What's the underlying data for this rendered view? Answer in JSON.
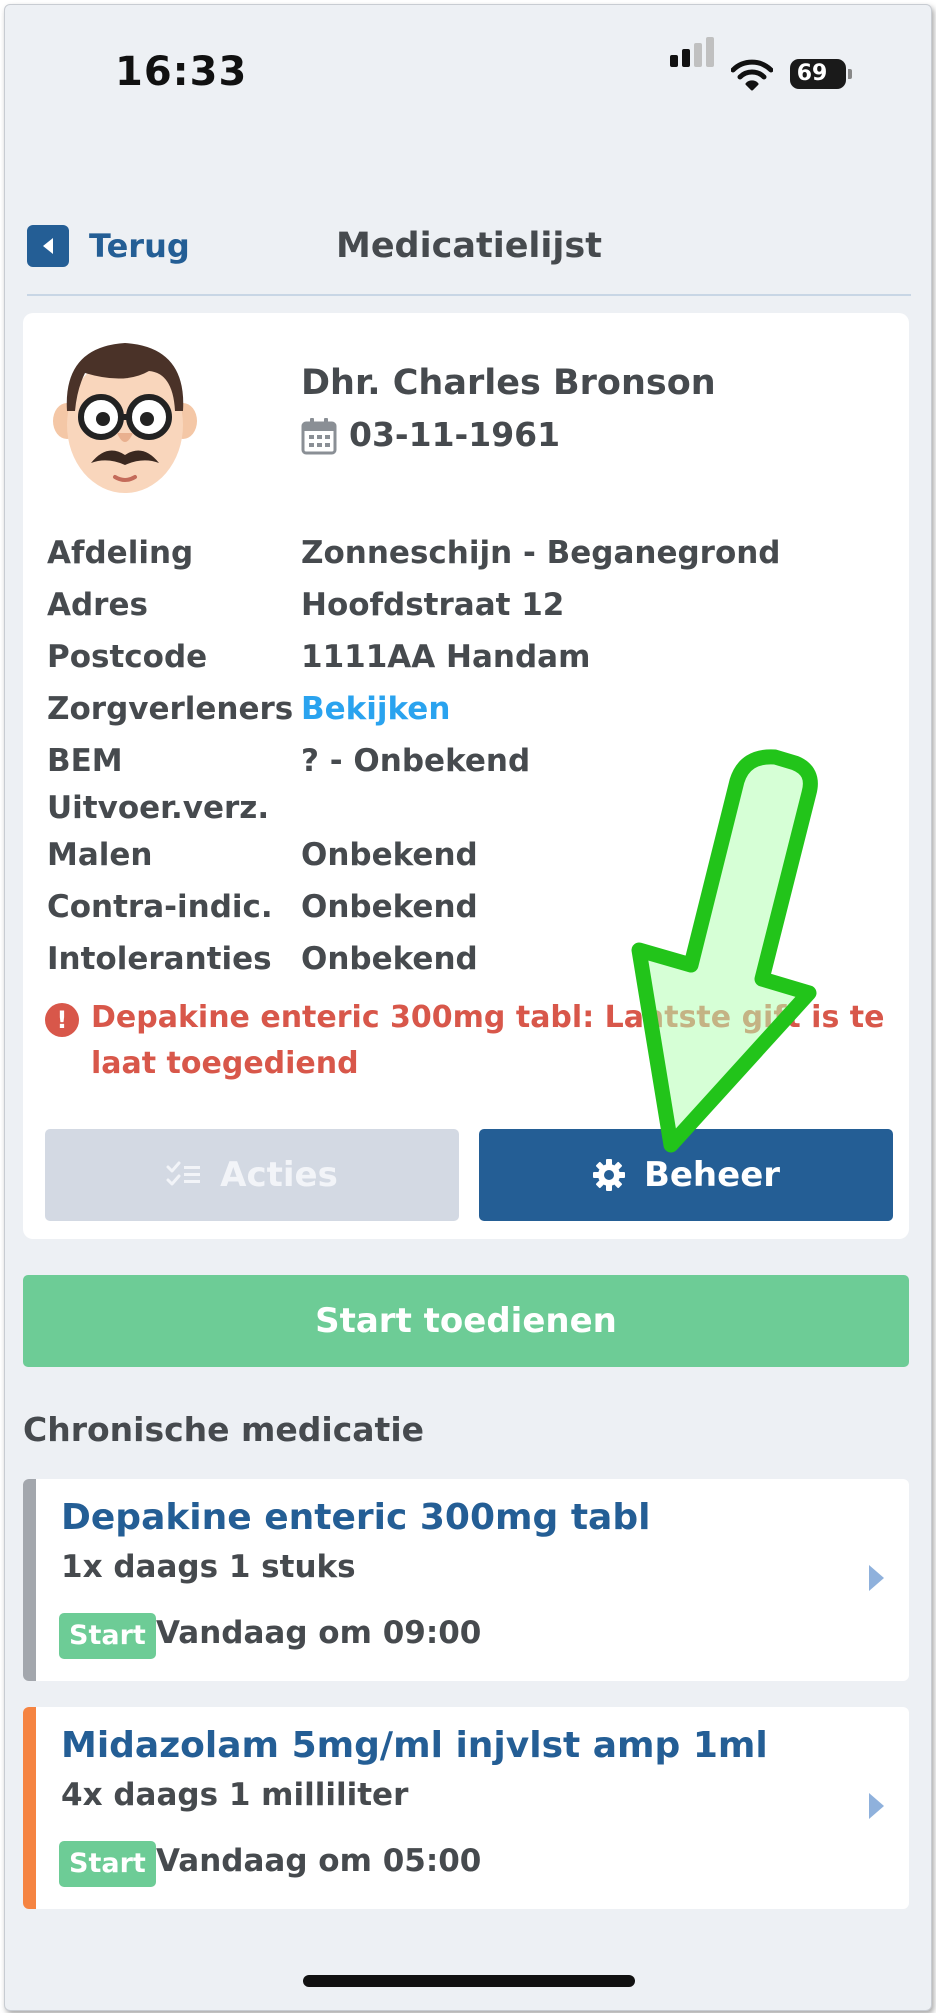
{
  "status_bar": {
    "time": "16:33",
    "battery": "69"
  },
  "nav": {
    "back_label": "Terug",
    "title": "Medicatielijst"
  },
  "patient": {
    "name": "Dhr. Charles Bronson",
    "dob": "03-11-1961",
    "fields": [
      {
        "label": "Afdeling",
        "value": "Zonneschijn - Beganegrond"
      },
      {
        "label": "Adres",
        "value": "Hoofdstraat 12"
      },
      {
        "label": "Postcode",
        "value": "1111AA Handam"
      },
      {
        "label": "Zorgverleners",
        "value": "Bekijken"
      },
      {
        "label": "BEM",
        "value": "? - Onbekend"
      },
      {
        "label": "Uitvoer.verz.",
        "value": ""
      },
      {
        "label": "Malen",
        "value": "Onbekend"
      },
      {
        "label": "Contra-indic.",
        "value": "Onbekend"
      },
      {
        "label": "Intoleranties",
        "value": "Onbekend"
      }
    ],
    "alert": "Depakine enteric 300mg tabl: Laatste gift is te laat toegediend"
  },
  "actions": {
    "acties_label": "Acties",
    "beheer_label": "Beheer"
  },
  "start_button_label": "Start toedienen",
  "section_title": "Chronische medicatie",
  "medications": [
    {
      "name": "Depakine enteric 300mg tabl",
      "dose": "1x daags 1 stuks",
      "badge": "Start",
      "time": "Vandaag om 09:00",
      "bar_color": "#a3a7ad"
    },
    {
      "name": "Midazolam 5mg/ml injvlst amp 1ml",
      "dose": "4x daags 1 milliliter",
      "badge": "Start",
      "time": "Vandaag om 05:00",
      "bar_color": "#f58442"
    }
  ],
  "colors": {
    "primary": "#245e95",
    "success": "#6dcc96",
    "danger": "#d8574a",
    "link": "#2aa3ef",
    "annotation_arrow": "#22c41a"
  }
}
